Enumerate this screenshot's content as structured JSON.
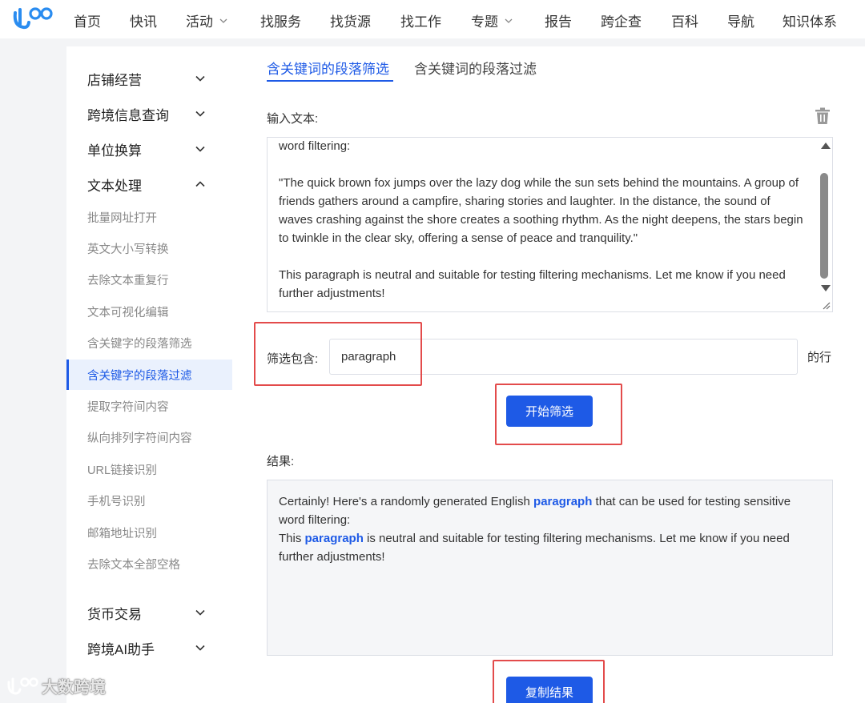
{
  "nav": {
    "items": [
      {
        "label": "首页",
        "dropdown": false
      },
      {
        "label": "快讯",
        "dropdown": false
      },
      {
        "label": "活动",
        "dropdown": true
      },
      {
        "label": "找服务",
        "dropdown": false
      },
      {
        "label": "找货源",
        "dropdown": false
      },
      {
        "label": "找工作",
        "dropdown": false
      },
      {
        "label": "专题",
        "dropdown": true
      },
      {
        "label": "报告",
        "dropdown": false
      },
      {
        "label": "跨企查",
        "dropdown": false
      },
      {
        "label": "百科",
        "dropdown": false
      },
      {
        "label": "导航",
        "dropdown": false
      },
      {
        "label": "知识体系",
        "dropdown": false
      }
    ]
  },
  "sidebar": {
    "groups": [
      {
        "label": "店铺经营",
        "expanded": false
      },
      {
        "label": "跨境信息查询",
        "expanded": false
      },
      {
        "label": "单位换算",
        "expanded": false
      },
      {
        "label": "文本处理",
        "expanded": true
      },
      {
        "label": "货币交易",
        "expanded": false
      },
      {
        "label": "跨境AI助手",
        "expanded": false
      }
    ],
    "sub_items": [
      {
        "label": "批量网址打开",
        "active": false
      },
      {
        "label": "英文大小写转换",
        "active": false
      },
      {
        "label": "去除文本重复行",
        "active": false
      },
      {
        "label": "文本可视化编辑",
        "active": false
      },
      {
        "label": "含关键字的段落筛选",
        "active": false
      },
      {
        "label": "含关键字的段落过滤",
        "active": true
      },
      {
        "label": "提取字符间内容",
        "active": false
      },
      {
        "label": "纵向排列字符间内容",
        "active": false
      },
      {
        "label": "URL链接识别",
        "active": false
      },
      {
        "label": "手机号识别",
        "active": false
      },
      {
        "label": "邮箱地址识别",
        "active": false
      },
      {
        "label": "去除文本全部空格",
        "active": false
      }
    ]
  },
  "tabs": [
    {
      "label": "含关键词的段落筛选",
      "active": true
    },
    {
      "label": "含关键词的段落过滤",
      "active": false
    }
  ],
  "input_section": {
    "label": "输入文本:",
    "text": "word filtering:\n\n\"The quick brown fox jumps over the lazy dog while the sun sets behind the mountains. A group of friends gathers around a campfire, sharing stories and laughter. In the distance, the sound of waves crashing against the shore creates a soothing rhythm. As the night deepens, the stars begin to twinkle in the clear sky, offering a sense of peace and tranquility.\"\n\nThis paragraph is neutral and suitable for testing filtering mechanisms. Let me know if you need further adjustments!"
  },
  "filter": {
    "label": "筛选包含:",
    "value": "paragraph",
    "suffix": "的行",
    "button": "开始筛选"
  },
  "result": {
    "label": "结果:",
    "keyword": "paragraph",
    "line1_before": "Certainly! Here's a randomly generated English ",
    "line1_after": " that can be used for testing sensitive word filtering:",
    "line2_before": "This ",
    "line2_after": " is neutral and suitable for testing filtering mechanisms. Let me know if you need further adjustments!",
    "copy_button": "复制结果"
  },
  "watermark": {
    "text": "大数跨境"
  },
  "colors": {
    "accent": "#1e5ae6",
    "annotation": "#e34b4b",
    "page_bg": "#f3f4f6"
  }
}
